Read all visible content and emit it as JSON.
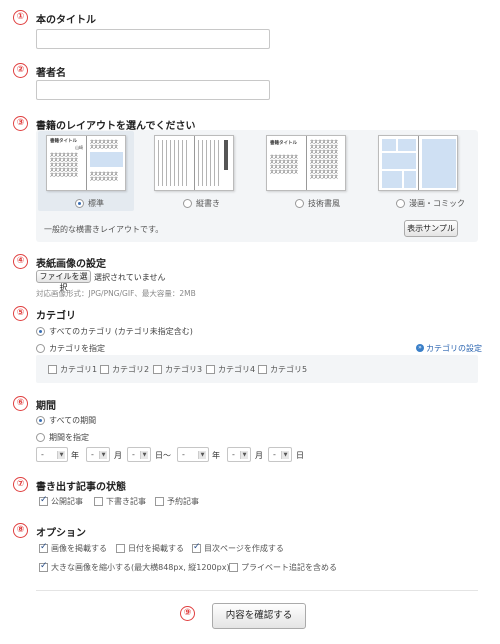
{
  "badges": [
    "①",
    "②",
    "③",
    "④",
    "⑤",
    "⑥",
    "⑦",
    "⑧",
    "⑨"
  ],
  "sections": {
    "book_title": "本のタイトル",
    "author": "著者名",
    "layout": "書籍のレイアウトを選んでください",
    "cover": "表紙画像の設定",
    "category": "カテゴリ",
    "period": "期間",
    "post_state": "書き出す記事の状態",
    "options": "オプション"
  },
  "layout": {
    "options": [
      {
        "label": "標準",
        "selected": true
      },
      {
        "label": "縦書き",
        "selected": false
      },
      {
        "label": "技術書風",
        "selected": false
      },
      {
        "label": "漫画・コミック",
        "selected": false
      }
    ],
    "thumb_title": "書籍タイトル",
    "thumb_sub": "山崎",
    "thumb_text": "文文文文文文文",
    "description": "一般的な横書きレイアウトです。",
    "sample_button": "表示サンプル"
  },
  "cover": {
    "file_button": "ファイルを選択",
    "file_status": "選択されていません",
    "hint": "対応画像形式：JPG/PNG/GIF、最大容量：2MB"
  },
  "category": {
    "all_label": "すべてのカテゴリ (カテゴリ未指定含む)",
    "specify_label": "カテゴリを指定",
    "settings_link": "カテゴリの設定",
    "items": [
      "カテゴリ1",
      "カテゴリ2",
      "カテゴリ3",
      "カテゴリ4",
      "カテゴリ5"
    ]
  },
  "period": {
    "all_label": "すべての期間",
    "specify_label": "期間を指定",
    "placeholder": "-",
    "year": "年",
    "month": "月",
    "day_from": "日～",
    "day": "日"
  },
  "post_state": {
    "items": [
      {
        "label": "公開記事",
        "checked": true
      },
      {
        "label": "下書き記事",
        "checked": false
      },
      {
        "label": "予約記事",
        "checked": false
      }
    ]
  },
  "options": {
    "items": [
      {
        "label": "画像を掲載する",
        "checked": true
      },
      {
        "label": "日付を掲載する",
        "checked": false
      },
      {
        "label": "目次ページを作成する",
        "checked": true
      },
      {
        "label": "大きな画像を縮小する(最大横848px, 縦1200px)",
        "checked": true
      },
      {
        "label": "プライベート追記を含める",
        "checked": false
      }
    ]
  },
  "submit_label": "内容を確認する"
}
